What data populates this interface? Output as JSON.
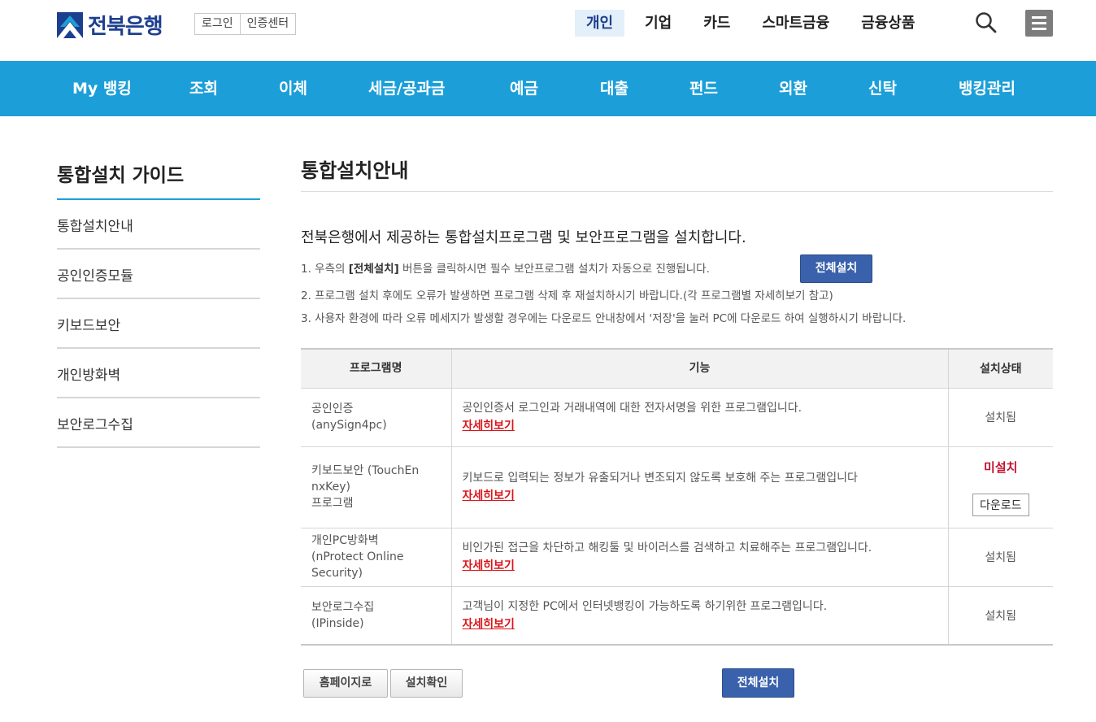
{
  "header": {
    "logo_text": "전북은행",
    "auth_links": [
      "로그인",
      "인증센터"
    ],
    "top_nav": [
      {
        "label": "개인",
        "active": true
      },
      {
        "label": "기업",
        "active": false
      },
      {
        "label": "카드",
        "active": false
      },
      {
        "label": "스마트금융",
        "active": false
      },
      {
        "label": "금융상품",
        "active": false
      }
    ],
    "search_icon": "search-icon",
    "menu_icon": "hamburger-menu-icon"
  },
  "gnb": [
    "My 뱅킹",
    "조회",
    "이체",
    "세금/공과금",
    "예금",
    "대출",
    "펀드",
    "외환",
    "신탁",
    "뱅킹관리"
  ],
  "sidebar": {
    "title": "통합설치 가이드",
    "items": [
      "통합설치안내",
      "공인인증모듈",
      "키보드보안",
      "개인방화벽",
      "보안로그수집"
    ]
  },
  "main": {
    "title": "통합설치안내",
    "lead": "전북은행에서 제공하는 통합설치프로그램 및 보안프로그램을 설치합니다.",
    "note1_pre": "1. 우측의 ",
    "note1_bold": "[전체설치]",
    "note1_post": " 버튼을 클릭하시면 필수 보안프로그램 설치가 자동으로 진행됩니다.",
    "note2": "2. 프로그램 설치 후에도 오류가 발생하면 프로그램 삭제 후 재설치하시기 바랍니다.(각 프로그램별 자세히보기 참고)",
    "note3": "3. 사용자 환경에 따라 오류 메세지가 발생할 경우에는 다운로드 안내창에서 '저장'을 눌러 PC에 다운로드 하여 실행하시기 바랍니다.",
    "install_all_label": "전체설치",
    "table": {
      "headers": [
        "프로그램명",
        "기능",
        "설치상태"
      ],
      "detail_label": "자세히보기",
      "rows": [
        {
          "name1": "공인인증",
          "name2": "(anySign4pc)",
          "name3": "",
          "desc": "공인인증서 로그인과 거래내역에 대한 전자서명을 위한 프로그램입니다.",
          "status": "설치됨"
        },
        {
          "name1": "키보드보안 (TouchEn",
          "name2": "nxKey)",
          "name3": "프로그램",
          "desc": "키보드로 입력되는 정보가 유출되거나 변조되지 않도록 보호해 주는 프로그램입니다",
          "status": "미설치",
          "download": "다운로드"
        },
        {
          "name1": "개인PC방화벽",
          "name2": "(nProtect Online Security)",
          "name3": "",
          "desc": "비인가된 접근을 차단하고 해킹툴 및 바이러스를 검색하고 치료해주는 프로그램입니다.",
          "status": "설치됨"
        },
        {
          "name1": "보안로그수집",
          "name2": "(IPinside)",
          "name3": "",
          "desc": "고객님이 지정한 PC에서 인터넷뱅킹이 가능하도록 하기위한 프로그램입니다.",
          "status": "설치됨"
        }
      ]
    },
    "bottom_buttons": {
      "home": "홈페이지로",
      "check": "설치확인",
      "install_all": "전체설치"
    }
  },
  "colors": {
    "brand_blue": "#1c9fd9",
    "navy": "#1d3f8f",
    "button_blue": "#3a61ac",
    "alert_red": "#c4102f"
  }
}
